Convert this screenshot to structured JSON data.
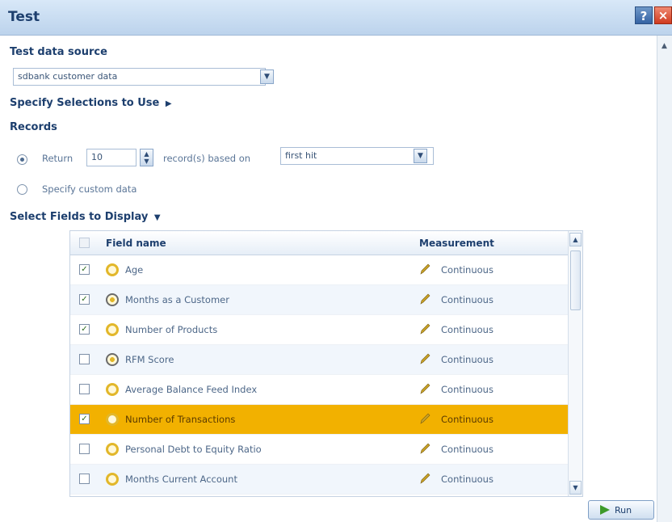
{
  "window": {
    "title": "Test",
    "help_label": "?",
    "close_label": "×"
  },
  "data_source": {
    "heading": "Test data source",
    "value": "sdbank customer data"
  },
  "selections": {
    "heading": "Specify Selections to Use",
    "toggle_glyph": "▶"
  },
  "records": {
    "heading": "Records",
    "return_label": "Return",
    "return_count": "10",
    "records_suffix": "record(s) based on",
    "based_on": "first hit",
    "custom_label": "Specify custom data",
    "selected_option": "return"
  },
  "fields_section": {
    "heading": "Select Fields to Display",
    "toggle_glyph": "▼"
  },
  "table": {
    "columns": {
      "field": "Field name",
      "measurement": "Measurement"
    },
    "rows": [
      {
        "checked": true,
        "icon": "continuous-field-icon",
        "name": "Age",
        "measurement": "Continuous",
        "selected": false
      },
      {
        "checked": true,
        "icon": "set-field-icon",
        "name": "Months as a Customer",
        "measurement": "Continuous",
        "selected": false
      },
      {
        "checked": true,
        "icon": "continuous-field-icon",
        "name": "Number of Products",
        "measurement": "Continuous",
        "selected": false
      },
      {
        "checked": false,
        "icon": "set-field-icon",
        "name": "RFM Score",
        "measurement": "Continuous",
        "selected": false
      },
      {
        "checked": false,
        "icon": "continuous-field-icon",
        "name": "Average Balance Feed Index",
        "measurement": "Continuous",
        "selected": false
      },
      {
        "checked": true,
        "icon": "continuous-field-icon",
        "name": "Number of Transactions",
        "measurement": "Continuous",
        "selected": true
      },
      {
        "checked": false,
        "icon": "continuous-field-icon",
        "name": "Personal Debt to Equity Ratio",
        "measurement": "Continuous",
        "selected": false
      },
      {
        "checked": false,
        "icon": "continuous-field-icon",
        "name": "Months Current Account",
        "measurement": "Continuous",
        "selected": false
      }
    ]
  },
  "run_button": {
    "label": "Run"
  },
  "colors": {
    "selected_row": "#f2b100",
    "title_text": "#1d3f6e",
    "pencil": "#c9a227"
  }
}
